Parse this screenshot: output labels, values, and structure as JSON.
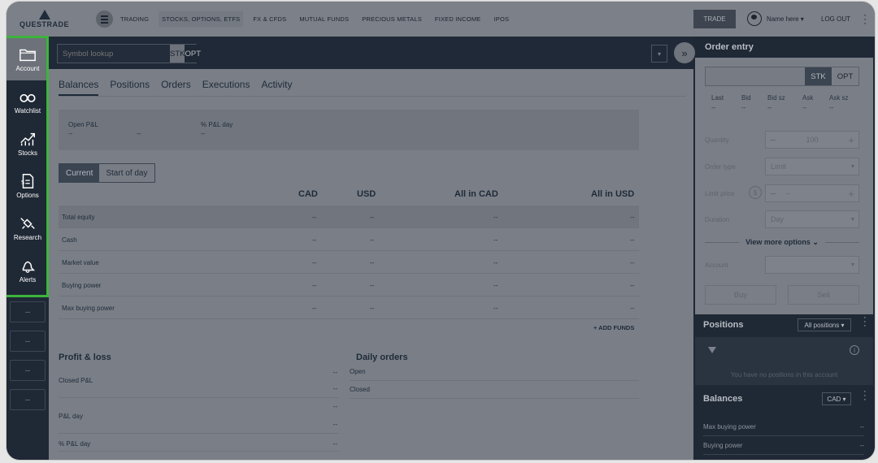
{
  "logo": {
    "text": "QUESTRADE"
  },
  "topnav": {
    "items": [
      "TRADING",
      "STOCKS, OPTIONS, ETFS",
      "FX & CFDS",
      "MUTUAL FUNDS",
      "PRECIOUS METALS",
      "FIXED INCOME",
      "IPOS"
    ],
    "trade_label": "TRADE",
    "user_name": "Name here ▾",
    "logout_label": "LOG OUT"
  },
  "sidebar": {
    "items": [
      {
        "label": "Account",
        "icon": "folder-icon"
      },
      {
        "label": "Watchlist",
        "icon": "binoculars-icon"
      },
      {
        "label": "Stocks",
        "icon": "chart-up-icon"
      },
      {
        "label": "Options",
        "icon": "document-dollar-icon"
      },
      {
        "label": "Research",
        "icon": "satellite-icon"
      },
      {
        "label": "Alerts",
        "icon": "bell-icon"
      }
    ],
    "small_items": [
      "--",
      "--",
      "--",
      "--"
    ]
  },
  "symbol_lookup": {
    "placeholder": "Symbol lookup",
    "stk": "STK",
    "opt": "OPT"
  },
  "tabs": [
    "Balances",
    "Positions",
    "Orders",
    "Executions",
    "Activity"
  ],
  "pnl": {
    "open_label": "Open P&L",
    "open_value": "--",
    "mid_value": "--",
    "pct_label": "% P&L day",
    "pct_value": "--"
  },
  "toggle": {
    "current": "Current",
    "start": "Start of day"
  },
  "balances": {
    "columns": [
      "CAD",
      "USD",
      "All in CAD",
      "All in USD"
    ],
    "rows": [
      {
        "name": "Total equity",
        "values": [
          "--",
          "--",
          "--",
          "--"
        ]
      },
      {
        "name": "Cash",
        "values": [
          "--",
          "--",
          "--",
          "--"
        ]
      },
      {
        "name": "Market value",
        "values": [
          "--",
          "--",
          "--",
          "--"
        ]
      },
      {
        "name": "Buying power",
        "values": [
          "--",
          "--",
          "--",
          "--"
        ]
      },
      {
        "name": "Max buying power",
        "values": [
          "--",
          "--",
          "--",
          "--"
        ]
      }
    ],
    "add_funds": "+ ADD FUNDS"
  },
  "profit_loss": {
    "title": "Profit & loss",
    "closed_label": "Closed P&L",
    "closed_value": "--",
    "pl_day_label": "P&L day",
    "pl_day_value_top": "--",
    "pl_day_value_bottom": "--",
    "pct_day_label": "% P&L day",
    "pct_day_value": "--",
    "extra_value": "--"
  },
  "daily_orders": {
    "title": "Daily orders",
    "rows": [
      "Open",
      "Closed"
    ]
  },
  "order_entry": {
    "title": "Order entry",
    "stk": "STK",
    "opt": "OPT",
    "quote_labels": [
      "Last",
      "Bid",
      "Bid sz",
      "Ask",
      "Ask sz"
    ],
    "quote_values": [
      "--",
      "--",
      "--",
      "--",
      "--"
    ],
    "quantity_label": "Quantity",
    "quantity_value": "100",
    "order_type_label": "Order type",
    "order_type_value": "Limit",
    "limit_price_label": "Limit price",
    "limit_price_value": "--",
    "duration_label": "Duration",
    "duration_value": "Day",
    "more_options": "View more options ⌄",
    "account_label": "Account",
    "account_value": "",
    "buy": "Buy",
    "sell": "Sell"
  },
  "positions": {
    "title": "Positions",
    "filter_value": "All positions ▾",
    "empty": "You have no positions in this account"
  },
  "right_balances": {
    "title": "Balances",
    "currency": "CAD ▾",
    "rows": [
      {
        "name": "Max buying power",
        "value": "--"
      },
      {
        "name": "Buying power",
        "value": "--"
      }
    ]
  },
  "colors": {
    "highlight": "#3cb43c",
    "sidebar_bg": "#1f2835"
  }
}
